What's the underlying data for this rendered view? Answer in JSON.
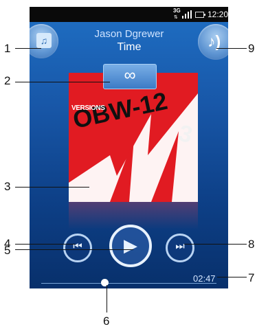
{
  "status_bar": {
    "network": "3G",
    "time": "12:20"
  },
  "track": {
    "artist": "Jason Dgrewer",
    "title": "Time"
  },
  "album_art": {
    "label": "VERSIONS",
    "colors": {
      "background": "#e11b22",
      "shape": "#ffffff"
    }
  },
  "buttons": {
    "library_icon": "music-library-icon",
    "infinite_icon": "infinite-icon",
    "visualizer_icon": "music-note-icon",
    "previous_icon": "previous-icon",
    "play_icon": "play-icon",
    "next_icon": "next-icon"
  },
  "progress": {
    "elapsed": "02:47",
    "position_fraction": 0.37
  },
  "callouts": [
    "1",
    "2",
    "3",
    "4",
    "5",
    "6",
    "7",
    "8",
    "9"
  ],
  "colors": {
    "accent": "#1f6fc4",
    "background": "#08306b"
  }
}
